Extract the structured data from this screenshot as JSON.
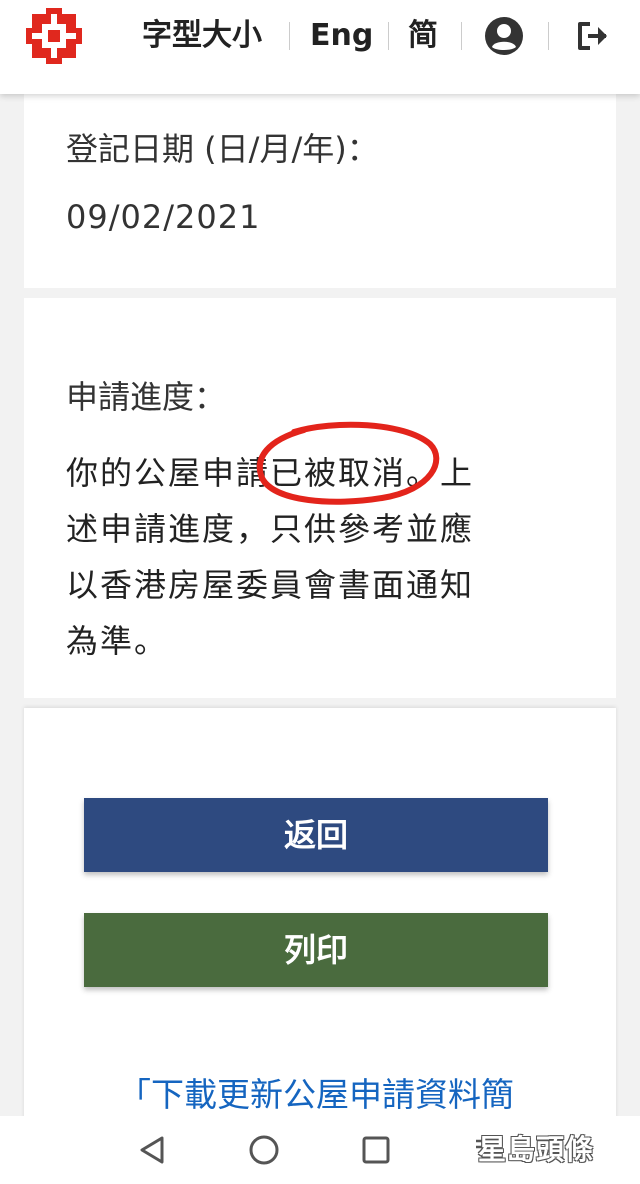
{
  "header": {
    "logo_icon": "hk-housing-authority-logo",
    "font_size_label": "字型大小",
    "english_label": "Eng",
    "simplified_label": "简",
    "account_icon": "account-circle-icon",
    "logout_icon": "logout-icon"
  },
  "registration": {
    "date_label": "登記日期 (日/月/年)：",
    "date_value": "09/02/2021"
  },
  "progress": {
    "label": "申請進度：",
    "status_lines": [
      "你的公屋申請已被取消。上",
      "述申請進度，只供參考並應",
      "以香港房屋委員會書面通知",
      "為準。"
    ],
    "highlighted_phrase": "已被取消"
  },
  "actions": {
    "back_label": "返回",
    "print_label": "列印",
    "download_link": "「下載更新公屋申請資料簡"
  },
  "navbar": {
    "back_icon": "triangle-back-icon",
    "home_icon": "circle-home-icon",
    "recents_icon": "square-recents-icon"
  },
  "watermark": {
    "text": "星島頭條"
  },
  "colors": {
    "back_button": "#2e4a80",
    "print_button": "#4a6b3e",
    "link": "#1565c0",
    "logo": "#e0281e",
    "highlight_circle": "#e3241b"
  }
}
